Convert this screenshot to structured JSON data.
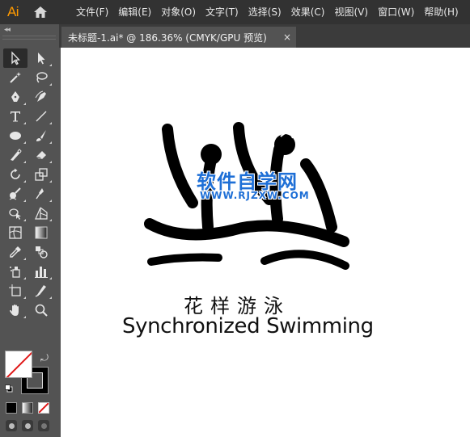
{
  "app": {
    "logo_text": "Ai",
    "accent_color": "#ff9a00"
  },
  "menu": {
    "items": [
      {
        "label": "文件(F)"
      },
      {
        "label": "编辑(E)"
      },
      {
        "label": "对象(O)"
      },
      {
        "label": "文字(T)"
      },
      {
        "label": "选择(S)"
      },
      {
        "label": "效果(C)"
      },
      {
        "label": "视图(V)"
      },
      {
        "label": "窗口(W)"
      },
      {
        "label": "帮助(H)"
      }
    ]
  },
  "toolbar": {
    "collapse_icon": "double-chevron-left-icon",
    "tools": [
      "selection-tool-icon",
      "direct-selection-tool-icon",
      "magic-wand-tool-icon",
      "lasso-tool-icon",
      "pen-tool-icon",
      "curvature-tool-icon",
      "type-tool-icon",
      "line-segment-tool-icon",
      "ellipse-tool-icon",
      "paintbrush-tool-icon",
      "shaper-tool-icon",
      "eraser-tool-icon",
      "rotate-tool-icon",
      "scale-tool-icon",
      "warp-tool-icon",
      "free-transform-tool-icon",
      "shape-builder-tool-icon",
      "perspective-grid-tool-icon",
      "mesh-tool-icon",
      "gradient-tool-icon",
      "eyedropper-tool-icon",
      "blend-tool-icon",
      "symbol-sprayer-tool-icon",
      "column-graph-tool-icon",
      "artboard-tool-icon",
      "slice-tool-icon",
      "hand-tool-icon",
      "zoom-tool-icon"
    ],
    "fill_color": "#ffffff",
    "stroke_color": "#000000"
  },
  "document": {
    "tab_title": "未标题-1.ai* @ 186.36% (CMYK/GPU 预览)",
    "close_label": "×"
  },
  "artwork": {
    "title_cn": "花样游泳",
    "title_en": "Synchronized Swimming",
    "watermark_cn": "软件自学网",
    "watermark_url": "WWW.RJZXW.COM",
    "watermark_color": "#1e6fd6"
  }
}
